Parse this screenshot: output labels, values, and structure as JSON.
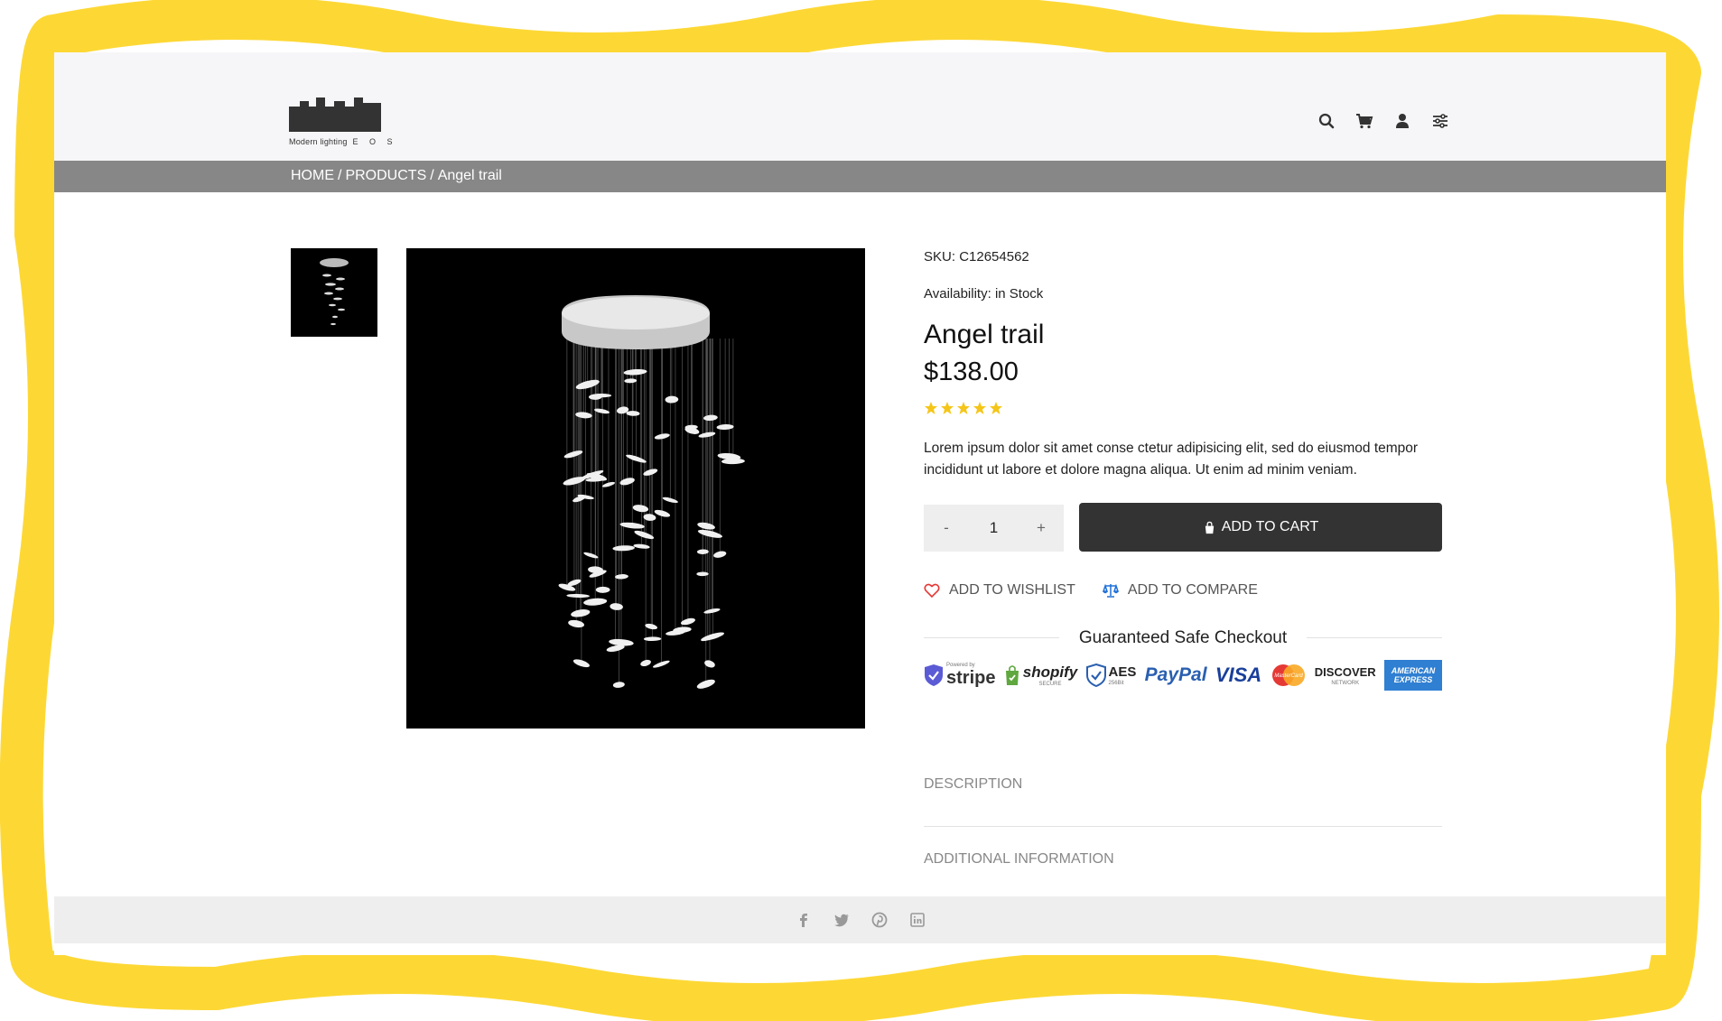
{
  "header": {
    "logo_caption": "Modern lighting",
    "logo_letters": "E O S"
  },
  "breadcrumb": {
    "home": "HOME",
    "products": "PRODUCTS",
    "current": "Angel trail",
    "separator": "/"
  },
  "product": {
    "sku_label": "SKU:",
    "sku": "C12654562",
    "availability_label": "Availability:",
    "availability": "in Stock",
    "name": "Angel trail",
    "price": "$138.00",
    "rating": 5,
    "description": "Lorem ipsum dolor sit amet conse ctetur adipisicing elit, sed do eiusmod tempor incididunt ut labore et dolore magna aliqua. Ut enim ad minim veniam.",
    "quantity": "1",
    "minus": "-",
    "plus": "+",
    "add_to_cart": "ADD TO CART",
    "add_to_wishlist": "ADD TO WISHLIST",
    "add_to_compare": "ADD TO COMPARE"
  },
  "checkout": {
    "title": "Guaranteed Safe Checkout",
    "badges": {
      "stripe_small": "Powered by",
      "stripe": "stripe",
      "shopify": "shopify",
      "shopify_small": "SECURE",
      "aes": "AES",
      "aes_small": "256Bit",
      "paypal": "PayPal",
      "visa": "VISA",
      "mastercard": "MasterCard",
      "discover": "DISCOVER",
      "discover_small": "NETWORK",
      "amex": "AMERICAN EXPRESS"
    }
  },
  "tabs": {
    "description": "DESCRIPTION",
    "additional": "ADDITIONAL INFORMATION"
  },
  "colors": {
    "frame": "#fdd835",
    "breadcrumb_bar": "#878787",
    "button_dark": "#333333",
    "star": "#f5c518",
    "wishlist_heart": "#e53935",
    "compare_icon": "#1e6fd9"
  }
}
